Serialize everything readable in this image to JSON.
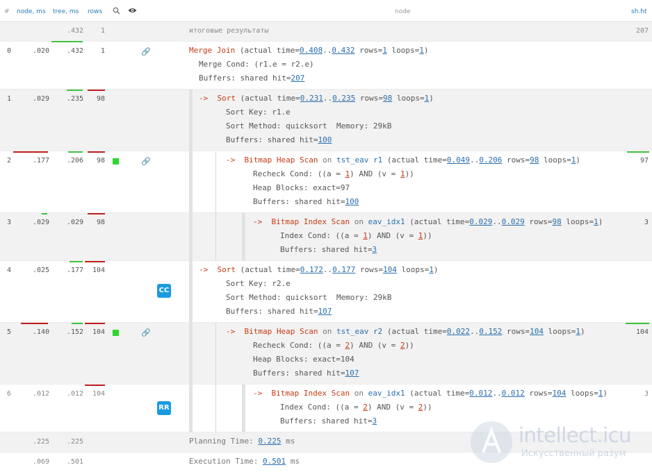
{
  "header": {
    "hash": "#",
    "node_ms": "node, ms",
    "tree_ms": "tree, ms",
    "rows": "rows",
    "search_icon": "magnifier",
    "eye_icon": "eye",
    "node": "node",
    "sh_ht": "sh.ht"
  },
  "summary": {
    "tree_ms": ".432",
    "rows": "1",
    "label": "итоговые результаты",
    "sh_ht": "207"
  },
  "rows": [
    {
      "id": "0",
      "node_ms": ".020",
      "tree_ms": ".432",
      "rows": "1"
    },
    {
      "id": "1",
      "node_ms": ".029",
      "tree_ms": ".235",
      "rows": "98"
    },
    {
      "id": "2",
      "node_ms": ".177",
      "tree_ms": ".206",
      "rows": "98",
      "sh_ht": "97"
    },
    {
      "id": "3",
      "node_ms": ".029",
      "tree_ms": ".029",
      "rows": "98",
      "sh_ht": "3"
    },
    {
      "id": "4",
      "node_ms": ".025",
      "tree_ms": ".177",
      "rows": "104",
      "badge": "CC"
    },
    {
      "id": "5",
      "node_ms": ".140",
      "tree_ms": ".152",
      "rows": "104",
      "sh_ht": "104"
    },
    {
      "id": "6",
      "node_ms": ".012",
      "tree_ms": ".012",
      "rows": "104",
      "sh_ht": "3",
      "badge": "RR"
    }
  ],
  "plan": {
    "n0": {
      "name": "Merge Join",
      "t1": "0.408",
      "t2": "0.432",
      "rows": "1",
      "loops": "1",
      "cond": "Merge Cond: (r1.e = r2.e)",
      "hit": "207"
    },
    "n1": {
      "name": "Sort",
      "t1": "0.231",
      "t2": "0.235",
      "rows": "98",
      "loops": "1",
      "key": "Sort Key: r1.e",
      "method": "Sort Method: quicksort  Memory: 29kB",
      "hit": "100"
    },
    "n2": {
      "name": "Bitmap Heap Scan",
      "rel": "tst_eav",
      "alias": "r1",
      "t1": "0.049",
      "t2": "0.206",
      "rows": "98",
      "loops": "1",
      "a": "1",
      "v": "1",
      "blocks": "Heap Blocks: exact=97",
      "hit": "100"
    },
    "n3": {
      "name": "Bitmap Index Scan",
      "rel": "eav_idx1",
      "t1": "0.029",
      "t2": "0.029",
      "rows": "98",
      "loops": "1",
      "a": "1",
      "v": "1",
      "hit": "3"
    },
    "n4": {
      "name": "Sort",
      "t1": "0.172",
      "t2": "0.177",
      "rows": "104",
      "loops": "1",
      "key": "Sort Key: r2.e",
      "method": "Sort Method: quicksort  Memory: 29kB",
      "hit": "107"
    },
    "n5": {
      "name": "Bitmap Heap Scan",
      "rel": "tst_eav",
      "alias": "r2",
      "t1": "0.022",
      "t2": "0.152",
      "rows": "104",
      "loops": "1",
      "a": "2",
      "v": "2",
      "blocks": "Heap Blocks: exact=104",
      "hit": "107"
    },
    "n6": {
      "name": "Bitmap Index Scan",
      "rel": "eav_idx1",
      "t1": "0.012",
      "t2": "0.012",
      "rows": "104",
      "loops": "1",
      "a": "2",
      "v": "2",
      "hit": "3"
    }
  },
  "planning": {
    "node_ms": ".225",
    "tree_ms": ".225",
    "label": "Planning Time: ",
    "value": "0.225",
    "unit": " ms"
  },
  "execution": {
    "node_ms": ".069",
    "tree_ms": ".501",
    "label": "Execution Time: ",
    "value": "0.501",
    "unit": " ms"
  },
  "watermark": {
    "brand": "intellect.icu",
    "tagline": "Искусственный разум"
  },
  "colors": {
    "accent": "#2a7ab7",
    "keyword": "#c63b14",
    "bar_green": "#3ec43e",
    "bar_red": "#c01e1e",
    "badge": "#1a9be0"
  }
}
